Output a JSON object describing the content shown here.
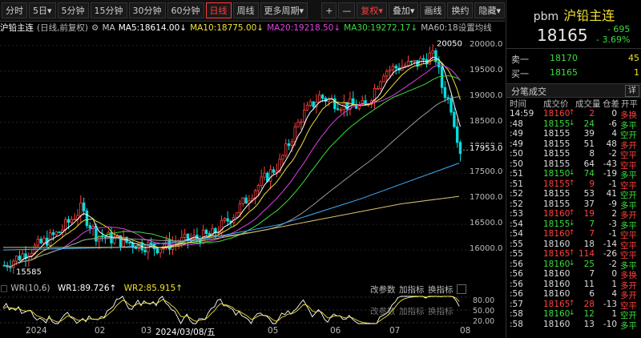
{
  "toolbar": {
    "left": [
      "分时",
      "5日▾",
      "5分钟",
      "15分钟",
      "30分钟",
      "60分钟",
      "日线",
      "周线",
      "更多周期▾"
    ],
    "active": "日线",
    "right": [
      "+",
      "—",
      "复权▾",
      "叠加▾",
      "画线",
      "换约",
      "隐藏▾"
    ]
  },
  "legend": {
    "title": "沪铅主连",
    "mode": "(日线,前复权)",
    "ma": [
      {
        "text": "MA",
        "color": "#cccccc"
      },
      {
        "text": "MA5:18614.00↓",
        "color": "#ffffff"
      },
      {
        "text": "MA10:18775.00↓",
        "color": "#f0e030"
      },
      {
        "text": "MA20:19218.50↓",
        "color": "#e040e0"
      },
      {
        "text": "MA30:19272.17↓",
        "color": "#3cdc3c"
      },
      {
        "text": "MA60:18设置均线",
        "color": "#bbbbbb"
      }
    ]
  },
  "yaxis": {
    "ticks": [
      "20000.0",
      "19500.0",
      "19000.0",
      "18500.0",
      "18000.0",
      "17500.0",
      "17000.0",
      "16500.0",
      "16000.0"
    ],
    "current": "17953.0",
    "high_label": "20050",
    "low_label": "15585"
  },
  "wr": {
    "name": "WR(10,6)",
    "wr1": "WR1:89.726↑",
    "wr2": "WR2:85.915↑",
    "buttons": [
      "改参数",
      "加指标",
      "换指标"
    ],
    "buttons2": [
      "改参数",
      "加指标",
      "换指标"
    ],
    "ticks": [
      "80.00",
      "50.00",
      "20.00"
    ]
  },
  "xaxis": {
    "labels": [
      "2024",
      "02",
      "03",
      "2024/03/08/五",
      "05",
      "06",
      "07",
      "08"
    ]
  },
  "quote": {
    "code": "pbm",
    "name": "沪铅主连",
    "price": "18165",
    "change": "- 695",
    "pct": "- 3.69%",
    "sell_label": "卖一",
    "sell_price": "18170",
    "sell_qty": "45",
    "buy_label": "买一",
    "buy_price": "18165",
    "buy_qty": "1"
  },
  "ticks_panel": {
    "title": "分笔成交",
    "detail_btn": "详",
    "headers": [
      "时间",
      "成交价",
      "成交量",
      "仓差",
      "开平"
    ],
    "rows": [
      {
        "time": "14:59",
        "price": "18160",
        "arrow": "↑",
        "ac": "r",
        "vol": "2",
        "diff": "0",
        "type": "多换"
      },
      {
        "time": ":48",
        "price": "18155",
        "arrow": "↓",
        "ac": "g",
        "vol": "24",
        "diff": "-6",
        "type": "多平"
      },
      {
        "time": ":49",
        "price": "18155",
        "arrow": "",
        "ac": "w",
        "vol": "39",
        "diff": "4",
        "type": "空开"
      },
      {
        "time": ":49",
        "price": "18155",
        "arrow": "",
        "ac": "w",
        "vol": "51",
        "diff": "48",
        "type": "多开"
      },
      {
        "time": ":50",
        "price": "18155",
        "arrow": "",
        "ac": "w",
        "vol": "8",
        "diff": "-2",
        "type": "空平"
      },
      {
        "time": ":50",
        "price": "18155",
        "arrow": "",
        "ac": "w",
        "vol": "64",
        "diff": "-43",
        "type": "空平"
      },
      {
        "time": ":51",
        "price": "18150",
        "arrow": "↓",
        "ac": "g",
        "vol": "74",
        "diff": "-19",
        "type": "多平"
      },
      {
        "time": ":51",
        "price": "18155",
        "arrow": "↑",
        "ac": "r",
        "vol": "9",
        "diff": "-1",
        "type": "空平"
      },
      {
        "time": ":52",
        "price": "18155",
        "arrow": "",
        "ac": "w",
        "vol": "53",
        "diff": "41",
        "type": "空开"
      },
      {
        "time": ":52",
        "price": "18155",
        "arrow": "",
        "ac": "w",
        "vol": "37",
        "diff": "-9",
        "type": "多平"
      },
      {
        "time": ":53",
        "price": "18160",
        "arrow": "↑",
        "ac": "r",
        "vol": "19",
        "diff": "2",
        "type": "多开"
      },
      {
        "time": ":54",
        "price": "18155",
        "arrow": "↓",
        "ac": "g",
        "vol": "7",
        "diff": "-3",
        "type": "多平"
      },
      {
        "time": ":54",
        "price": "18160",
        "arrow": "↑",
        "ac": "r",
        "vol": "7",
        "diff": "-1",
        "type": "空平"
      },
      {
        "time": ":55",
        "price": "18160",
        "arrow": "",
        "ac": "w",
        "vol": "18",
        "diff": "-14",
        "type": "空平"
      },
      {
        "time": ":55",
        "price": "18165",
        "arrow": "↑",
        "ac": "r",
        "vol": "114",
        "diff": "-26",
        "type": "空平"
      },
      {
        "time": ":56",
        "price": "18160",
        "arrow": "↓",
        "ac": "g",
        "vol": "25",
        "diff": "-2",
        "type": "多平"
      },
      {
        "time": ":56",
        "price": "18160",
        "arrow": "",
        "ac": "w",
        "vol": "7",
        "diff": "0",
        "type": "多换"
      },
      {
        "time": ":56",
        "price": "18160",
        "arrow": "",
        "ac": "w",
        "vol": "11",
        "diff": "1",
        "type": "多开"
      },
      {
        "time": ":56",
        "price": "18160",
        "arrow": "",
        "ac": "w",
        "vol": "6",
        "diff": "4",
        "type": "多开"
      },
      {
        "time": ":57",
        "price": "18165",
        "arrow": "↑",
        "ac": "r",
        "vol": "28",
        "diff": "-13",
        "type": "空平"
      },
      {
        "time": ":58",
        "price": "18160",
        "arrow": "↓",
        "ac": "g",
        "vol": "12",
        "diff": "1",
        "type": "空开"
      },
      {
        "time": ":58",
        "price": "18160",
        "arrow": "",
        "ac": "w",
        "vol": "13",
        "diff": "-10",
        "type": "多平"
      }
    ]
  },
  "colors": {
    "up": "#ff4040",
    "down": "#3cdc3c",
    "cyan": "#00e0e0",
    "accent": "#ff3b3b"
  }
}
